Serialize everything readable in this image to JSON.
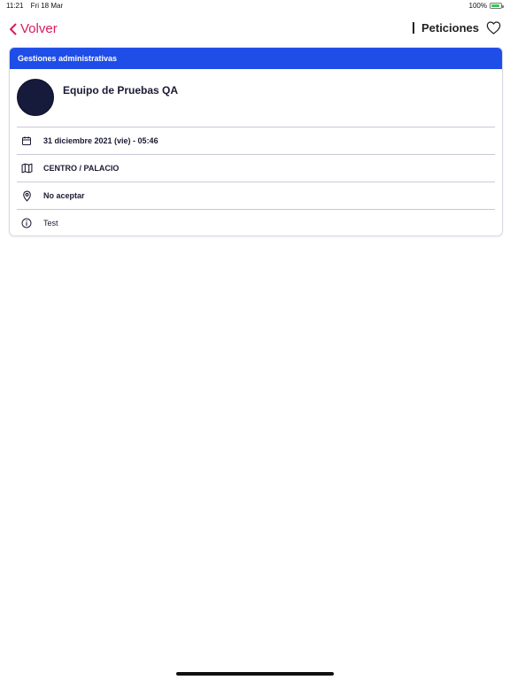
{
  "status_bar": {
    "time": "11:21",
    "date": "Fri 18 Mar",
    "battery": "100%"
  },
  "nav": {
    "back_label": "Volver",
    "title": "Peticiones"
  },
  "card": {
    "header": "Gestiones administrativas",
    "team_name": "Equipo de Pruebas QA",
    "rows": [
      {
        "icon": "calendar-icon",
        "text": "31 diciembre 2021 (vie) - 05:46"
      },
      {
        "icon": "map-icon",
        "text": "CENTRO / PALACIO"
      },
      {
        "icon": "location-pin-icon",
        "text": "No aceptar"
      },
      {
        "icon": "info-icon",
        "text": "Test"
      }
    ]
  },
  "colors": {
    "accent": "#d81b60",
    "header": "#1e4de8",
    "avatar": "#161a3b"
  }
}
